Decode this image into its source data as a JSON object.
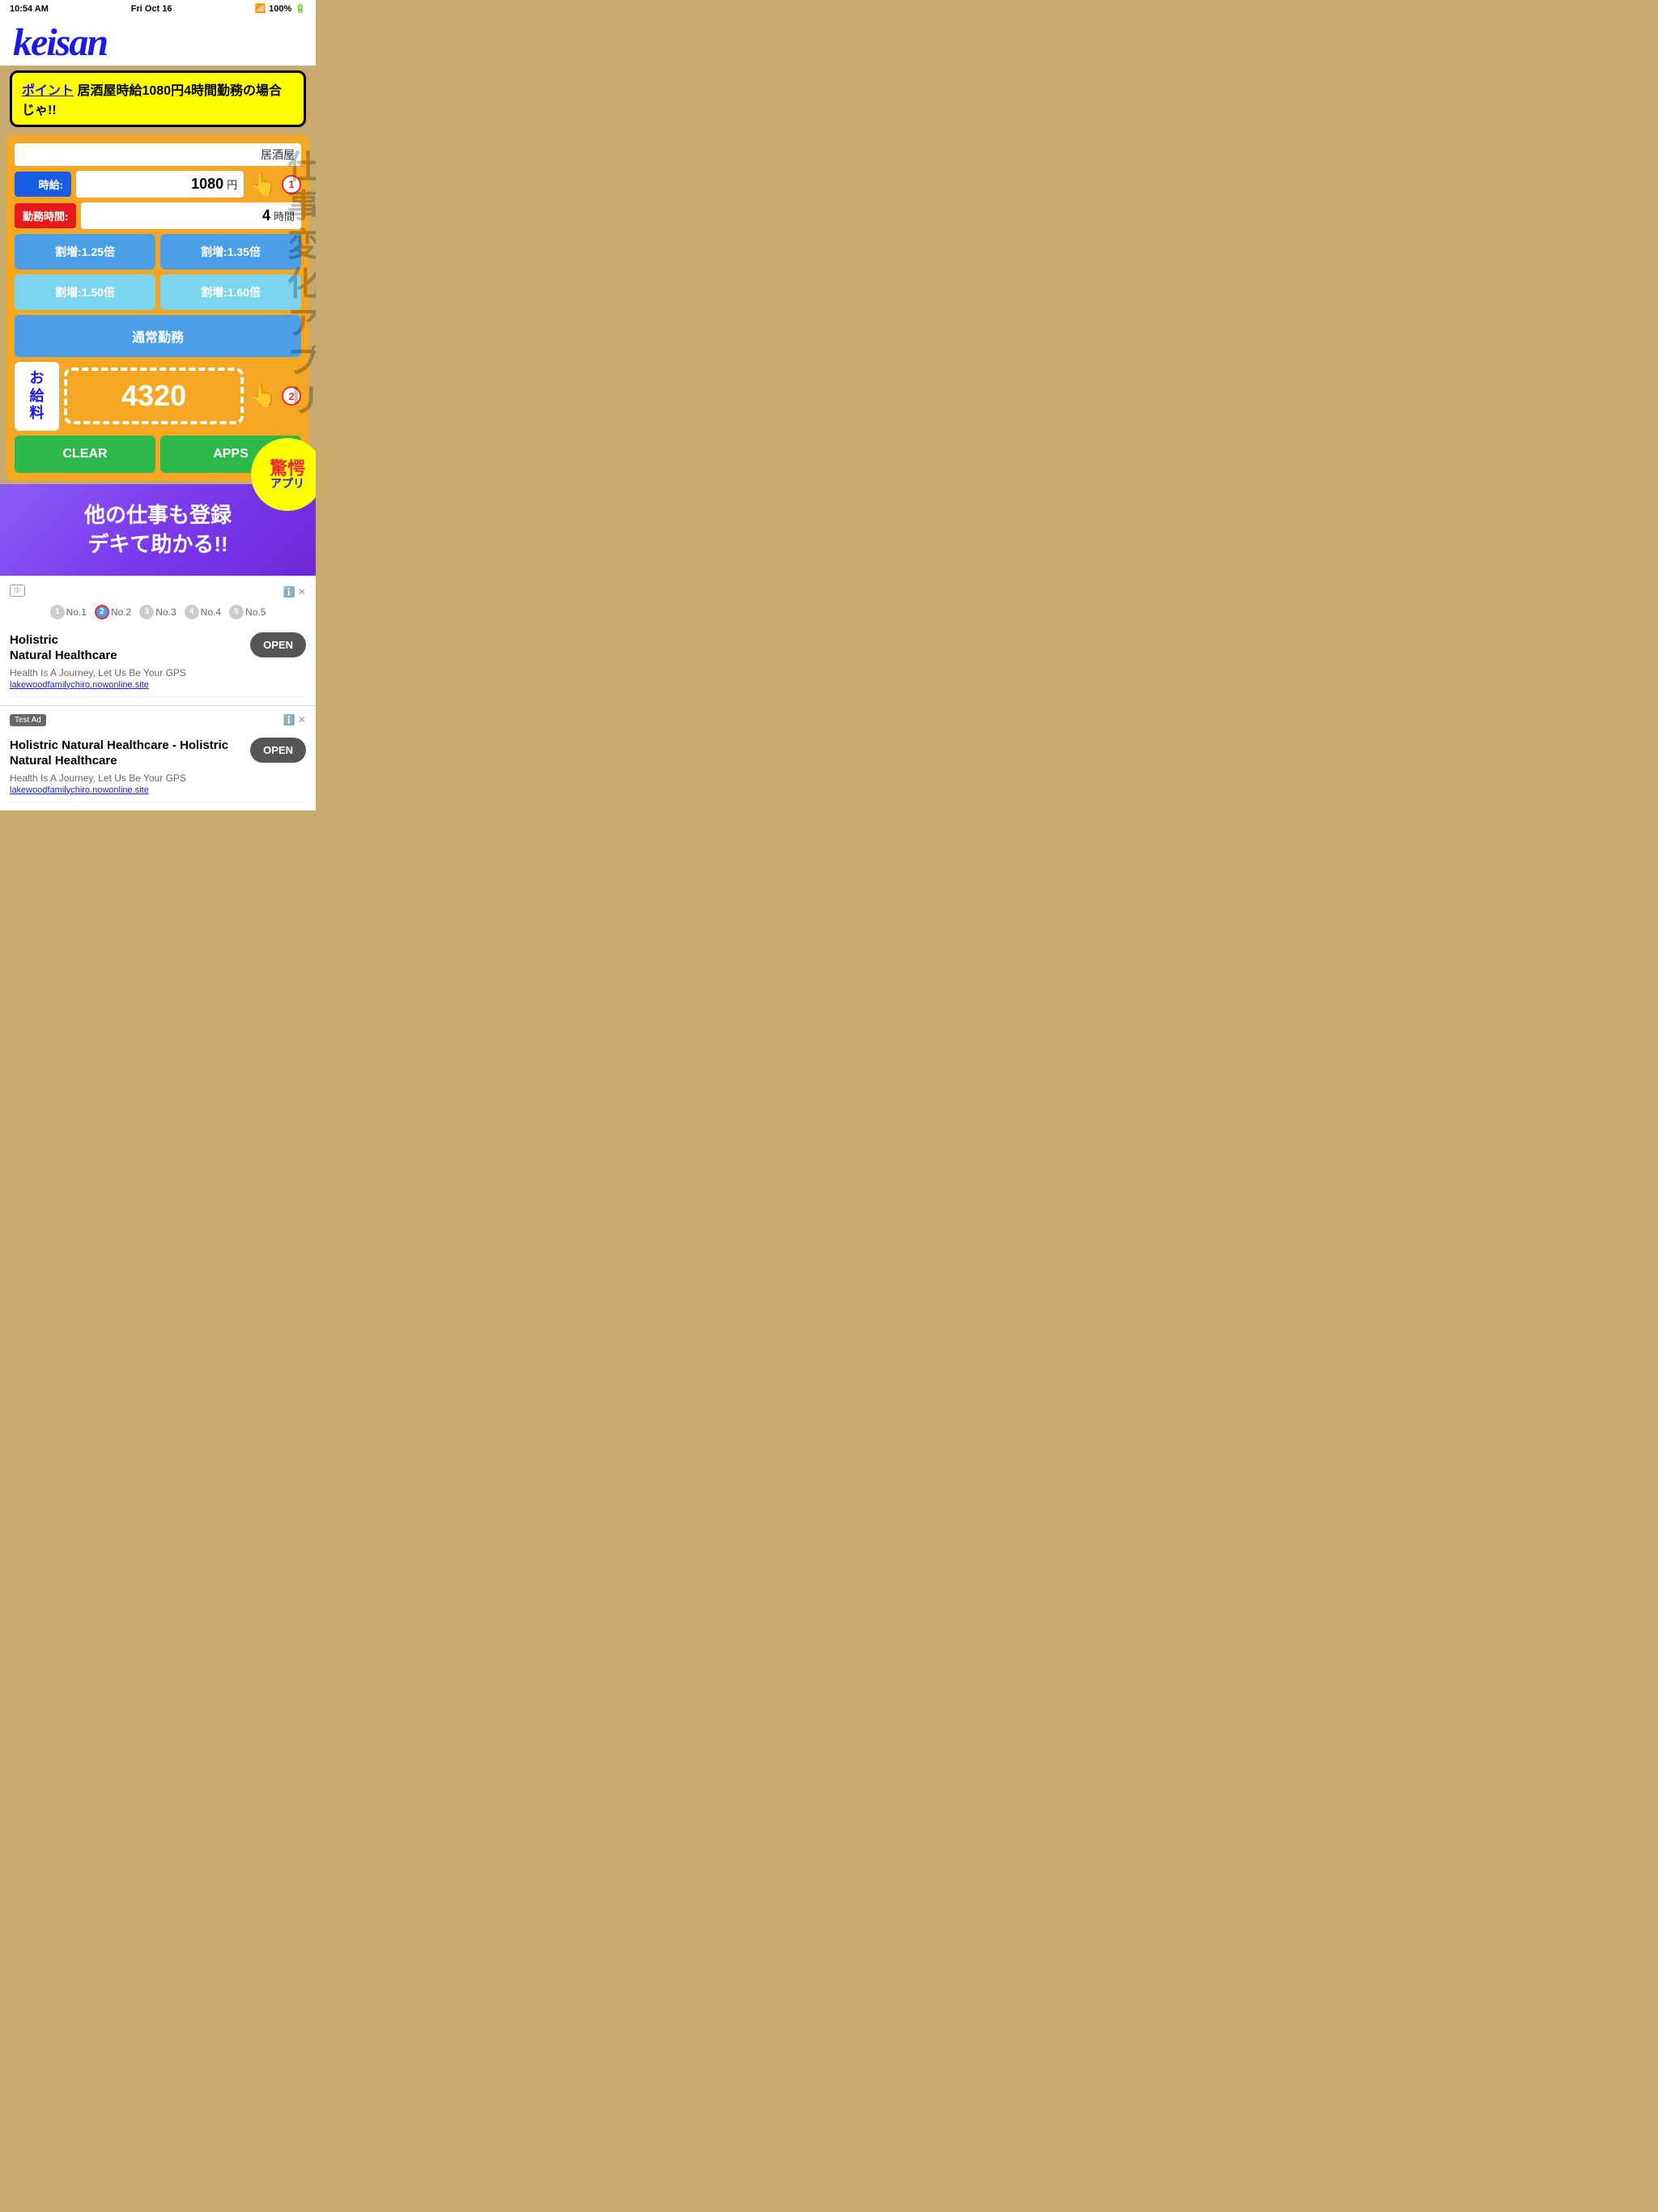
{
  "statusBar": {
    "time": "10:54 AM",
    "date": "Fri Oct 16",
    "signal": "WiFi",
    "battery": "100%"
  },
  "logo": {
    "text": "keisan"
  },
  "callout": {
    "title": "ポイント",
    "text": "居酒屋時給1080円4時間勤務の場合じゃ!!"
  },
  "calculator": {
    "izakayaLabel": "居酒屋",
    "hourlyLabel": "時給:",
    "hourlyValue": "1080",
    "hourlyUnit": "円",
    "workHoursLabel": "勤務時間:",
    "workHoursValue": "4",
    "workHoursUnit": "時間",
    "buttons": {
      "multiplier125": "割増:1.25倍",
      "multiplier135": "割増:1.35倍",
      "multiplier150": "割増:1.50倍",
      "multiplier160": "割増:1.60倍",
      "normalWork": "通常勤務"
    },
    "salaryLabel": "お\n給\n料",
    "salaryValue": "4320",
    "clearBtn": "CLEAR",
    "appsBtn": "APPS"
  },
  "promo": {
    "text": "他の仕事も登録\nデキて助かる!!"
  },
  "starburst": {
    "main": "驚愕",
    "sub": "アプリ"
  },
  "ads": {
    "badge1": "①",
    "pagination": [
      {
        "num": "1",
        "label": "No.1"
      },
      {
        "num": "2",
        "label": "No.2",
        "active": true
      },
      {
        "num": "3",
        "label": "No.3"
      },
      {
        "num": "4",
        "label": "No.4"
      },
      {
        "num": "5",
        "label": "No.5"
      }
    ],
    "ad1": {
      "title": "Holistric Natural Healthcare - Holistric\nNatural Healthcare",
      "desc": "Health Is A Journey, Let Us Be Your GPS",
      "link": "lakewoodfamilychiro.nowonline.site",
      "openBtn": "OPEN",
      "testAdLabel": "Test Ad",
      "adLabel": "①",
      "closeLabel": "✕"
    },
    "ad2": {
      "title": "Holistric Natural Healthcare - Holistric\nNatural Healthcare",
      "desc": "Health Is A Journey, Let Us Be Your GPS",
      "link": "lakewoodfamilychiro.nowonline.site",
      "openBtn": "OPEN"
    }
  }
}
